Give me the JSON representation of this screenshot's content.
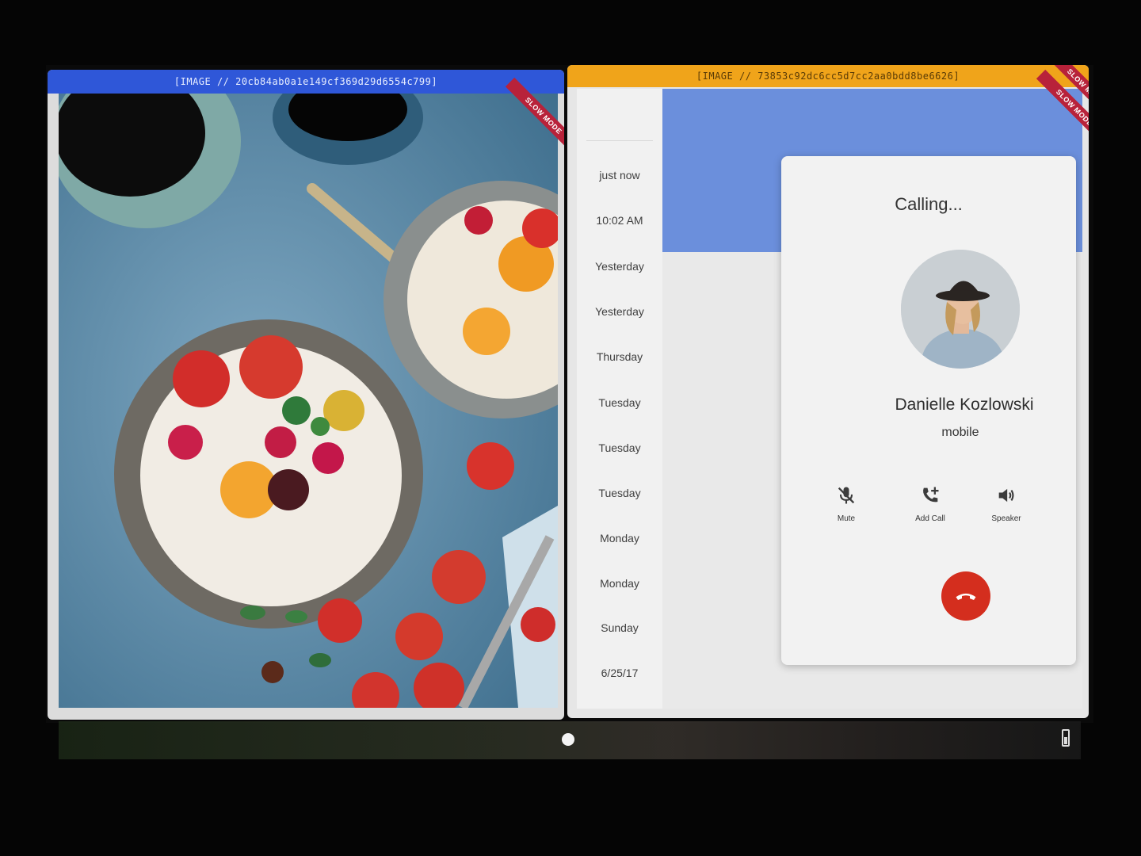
{
  "left_window": {
    "title": "[IMAGE // 20cb84ab0a1e149cf369d29d6554c799]",
    "ribbon": "SLOW MODE",
    "accent": "#2f57d8"
  },
  "right_window": {
    "title": "[IMAGE // 73853c92dc6cc5d7cc2aa0bdd8be6626]",
    "ribbon": "SLOW MODE",
    "accent": "#f0a41a"
  },
  "history": {
    "items": [
      "just now",
      "10:02 AM",
      "Yesterday",
      "Yesterday",
      "Thursday",
      "Tuesday",
      "Tuesday",
      "Tuesday",
      "Monday",
      "Monday",
      "Sunday",
      "6/25/17"
    ]
  },
  "call": {
    "status": "Calling...",
    "name": "Danielle Kozlowski",
    "type": "mobile",
    "actions": {
      "mute": "Mute",
      "add_call": "Add Call",
      "speaker": "Speaker"
    },
    "hangup_color": "#d42e1e",
    "header_color": "#6b8fdc"
  }
}
